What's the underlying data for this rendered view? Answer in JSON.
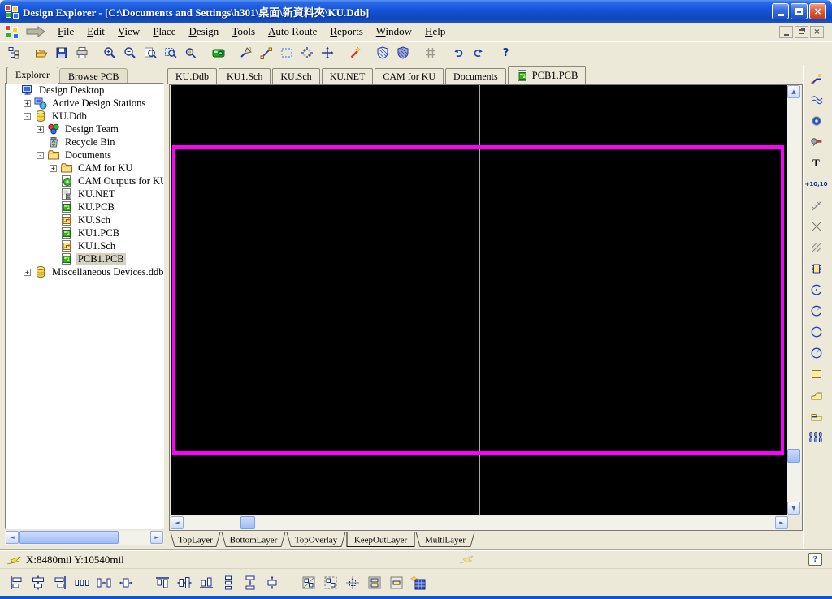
{
  "colors": {
    "titlebar_blue": "#1453d6",
    "window_frame": "#0a52d6",
    "panel": "#ece9d8",
    "canvas": "#000000",
    "board_outline": "#ff00ff",
    "selection": "#d6d2c2"
  },
  "window": {
    "title": "Design Explorer - [C:\\Documents and Settings\\h301\\桌面\\新資料夾\\KU.Ddb]",
    "controls": [
      {
        "name": "minimize-button"
      },
      {
        "name": "maximize-button"
      },
      {
        "name": "close-button",
        "glyph": "×"
      }
    ]
  },
  "menubar": {
    "items": [
      {
        "label": "File",
        "key": "F"
      },
      {
        "label": "Edit",
        "key": "E"
      },
      {
        "label": "View",
        "key": "V"
      },
      {
        "label": "Place",
        "key": "P"
      },
      {
        "label": "Design",
        "key": "D"
      },
      {
        "label": "Tools",
        "key": "T"
      },
      {
        "label": "Auto Route",
        "key": "A"
      },
      {
        "label": "Reports",
        "key": "R"
      },
      {
        "label": "Window",
        "key": "W"
      },
      {
        "label": "Help",
        "key": "H"
      }
    ],
    "mdi_controls": [
      {
        "name": "mdi-minimize-button"
      },
      {
        "name": "mdi-restore-button"
      },
      {
        "name": "mdi-close-button",
        "glyph": "×"
      }
    ]
  },
  "main_toolbar": {
    "buttons": [
      {
        "name": "toggle-design-manager-button",
        "icon": "design-manager-icon"
      },
      {
        "sep": true
      },
      {
        "name": "open-document-button",
        "icon": "open-folder-icon"
      },
      {
        "name": "save-button",
        "icon": "save-icon"
      },
      {
        "name": "print-button",
        "icon": "print-icon"
      },
      {
        "sep": true
      },
      {
        "name": "zoom-in-button",
        "icon": "zoom-in-icon"
      },
      {
        "name": "zoom-out-button",
        "icon": "zoom-out-icon"
      },
      {
        "name": "zoom-document-button",
        "icon": "zoom-document-icon"
      },
      {
        "name": "zoom-area-button",
        "icon": "zoom-area-icon"
      },
      {
        "name": "zoom-point-button",
        "icon": "zoom-point-icon"
      },
      {
        "sep": true
      },
      {
        "name": "cross-probe-button",
        "icon": "camera-icon"
      },
      {
        "sep": true
      },
      {
        "name": "knife-button",
        "icon": "knife-icon"
      },
      {
        "name": "place-line-button",
        "icon": "line-icon"
      },
      {
        "name": "select-area-button",
        "icon": "select-area-icon"
      },
      {
        "name": "move-selection-button",
        "icon": "move-dots-icon"
      },
      {
        "name": "move-object-button",
        "icon": "cross-arrows-icon"
      },
      {
        "sep": true
      },
      {
        "name": "wizard-button",
        "icon": "wand-icon"
      },
      {
        "sep": true
      },
      {
        "name": "polygon-draft-button",
        "icon": "shield-icon"
      },
      {
        "name": "polygon-final-button",
        "icon": "shield-filled-icon"
      },
      {
        "sep": true
      },
      {
        "name": "grid-button",
        "icon": "grid-icon"
      },
      {
        "sep": true
      },
      {
        "name": "undo-button",
        "icon": "undo-icon"
      },
      {
        "name": "redo-button",
        "icon": "redo-icon"
      },
      {
        "sep": true
      },
      {
        "name": "help-button",
        "icon": "help-icon",
        "glyph": "?"
      }
    ]
  },
  "explorer_panel": {
    "tabs": [
      {
        "label": "Explorer",
        "active": true
      },
      {
        "label": "Browse PCB",
        "active": false
      }
    ],
    "tree": [
      {
        "label": "Design Desktop",
        "depth": 0,
        "icon": "desktop-icon"
      },
      {
        "label": "Active Design Stations",
        "depth": 1,
        "icon": "workstation-icon",
        "expander": "+"
      },
      {
        "label": "KU.Ddb",
        "depth": 1,
        "icon": "database-icon",
        "expander": "-"
      },
      {
        "label": "Design Team",
        "depth": 2,
        "icon": "team-icon",
        "expander": "+"
      },
      {
        "label": "Recycle Bin",
        "depth": 2,
        "icon": "recycle-bin-icon"
      },
      {
        "label": "Documents",
        "depth": 2,
        "icon": "folder-icon",
        "expander": "-"
      },
      {
        "label": "CAM for KU",
        "depth": 3,
        "icon": "folder-icon",
        "expander": "+"
      },
      {
        "label": "CAM Outputs for KU",
        "depth": 3,
        "icon": "cam-doc-icon"
      },
      {
        "label": "KU.NET",
        "depth": 3,
        "icon": "net-doc-icon"
      },
      {
        "label": "KU.PCB",
        "depth": 3,
        "icon": "pcb-doc-icon"
      },
      {
        "label": "KU.Sch",
        "depth": 3,
        "icon": "sch-doc-icon"
      },
      {
        "label": "KU1.PCB",
        "depth": 3,
        "icon": "pcb-doc-icon"
      },
      {
        "label": "KU1.Sch",
        "depth": 3,
        "icon": "sch-doc-icon"
      },
      {
        "label": "PCB1.PCB",
        "depth": 3,
        "icon": "pcb-doc-icon",
        "selected": true
      },
      {
        "label": "Miscellaneous Devices.ddb",
        "depth": 1,
        "icon": "database-icon",
        "expander": "+"
      }
    ]
  },
  "document_tabs": [
    {
      "label": "KU.Ddb"
    },
    {
      "label": "KU1.Sch"
    },
    {
      "label": "KU.Sch"
    },
    {
      "label": "KU.NET"
    },
    {
      "label": "CAM for KU"
    },
    {
      "label": "Documents"
    },
    {
      "label": "PCB1.PCB",
      "active": true,
      "icon": "pcb-doc-icon"
    }
  ],
  "editor": {
    "layer_tabs": [
      {
        "label": "TopLayer"
      },
      {
        "label": "BottomLayer"
      },
      {
        "label": "TopOverlay"
      },
      {
        "label": "KeepOutLayer",
        "active": true
      },
      {
        "label": "MultiLayer"
      }
    ]
  },
  "placement_toolbar": {
    "buttons": [
      {
        "name": "interactive-routing-button",
        "icon": "route-icon"
      },
      {
        "name": "multiple-traces-button",
        "icon": "traces-icon"
      },
      {
        "name": "place-via-button",
        "icon": "via-icon"
      },
      {
        "name": "place-pad-button",
        "icon": "pad-icon"
      },
      {
        "name": "place-string-button",
        "icon": "string-icon",
        "glyph": "T",
        "glyph_class": "rt-glyph"
      },
      {
        "name": "place-coordinate-button",
        "icon": "coordinate-icon",
        "glyph": "+10,10",
        "glyph_class": "rt-glyph small"
      },
      {
        "name": "place-dimension-button",
        "icon": "dimension-icon"
      },
      {
        "name": "place-keepout-button",
        "icon": "keepout-icon"
      },
      {
        "name": "place-polygon-plane-button",
        "icon": "hatch-icon"
      },
      {
        "name": "place-component-button",
        "icon": "component-icon"
      },
      {
        "name": "place-arc-center-button",
        "icon": "arc-center-icon"
      },
      {
        "name": "place-arc-edge-button",
        "icon": "arc-edge-icon"
      },
      {
        "name": "place-arc-any-angle-button",
        "icon": "arc-any-icon"
      },
      {
        "name": "place-full-circle-button",
        "icon": "circle-icon"
      },
      {
        "name": "place-fill-button",
        "icon": "fill-icon"
      },
      {
        "name": "place-polygon-button",
        "icon": "polygon-icon"
      },
      {
        "name": "place-split-plane-button",
        "icon": "split-plane-icon"
      },
      {
        "name": "place-pad-array-button",
        "icon": "pad-array-icon",
        "glyph": "000 000",
        "glyph_class": "rt-glyph array"
      }
    ]
  },
  "status_bar": {
    "coordinates": "X:8480mil Y:10540mil",
    "help_glyph": "?"
  },
  "alignment_toolbar": {
    "buttons": [
      {
        "name": "align-left-button",
        "icon": "align-left-icon"
      },
      {
        "name": "align-horizontal-centers-button",
        "icon": "align-center-h-icon"
      },
      {
        "name": "align-right-button",
        "icon": "align-right-icon"
      },
      {
        "name": "make-horizontal-spacing-equal-button",
        "icon": "space-equal-h-icon"
      },
      {
        "name": "decrease-horizontal-spacing-button",
        "icon": "shrink-h-icon"
      },
      {
        "name": "increase-horizontal-spacing-button",
        "icon": "grow-h-icon"
      },
      {
        "sep": true
      },
      {
        "name": "align-top-button",
        "icon": "align-left-icon",
        "rot": 90
      },
      {
        "name": "align-vertical-centers-button",
        "icon": "align-center-h-icon",
        "rot": 90
      },
      {
        "name": "align-bottom-button",
        "icon": "align-right-icon",
        "rot": 90
      },
      {
        "name": "make-vertical-spacing-equal-button",
        "icon": "space-equal-h-icon",
        "rot": 90
      },
      {
        "name": "decrease-vertical-spacing-button",
        "icon": "shrink-h-icon",
        "rot": 90
      },
      {
        "name": "increase-vertical-spacing-button",
        "icon": "grow-h-icon",
        "rot": 90
      },
      {
        "sep": true
      },
      {
        "name": "arrange-within-room-button",
        "icon": "room-solid-icon"
      },
      {
        "name": "arrange-outside-board-button",
        "icon": "room-dashed-icon"
      },
      {
        "name": "snap-to-grid-button",
        "icon": "grid-cross-icon"
      },
      {
        "name": "stack-components-button",
        "icon": "comp-stack-icon"
      },
      {
        "name": "single-component-placement-button",
        "icon": "comp-single-icon"
      },
      {
        "name": "paste-array-button",
        "icon": "paste-array-icon"
      }
    ]
  }
}
